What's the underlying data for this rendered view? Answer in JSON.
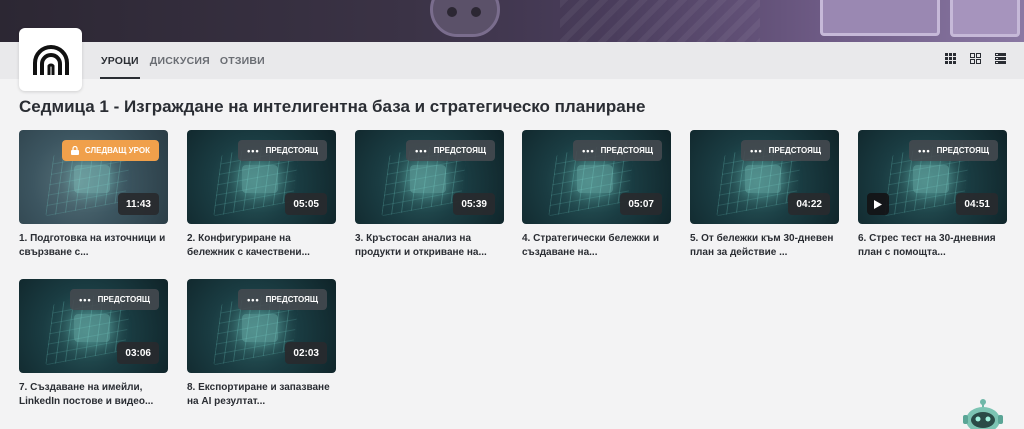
{
  "tabs": [
    {
      "label": "УРОЦИ",
      "active": true
    },
    {
      "label": "ДИСКУСИЯ",
      "active": false
    },
    {
      "label": "ОТЗИВИ",
      "active": false
    }
  ],
  "view_icons": [
    "grid-small-icon",
    "grid-large-icon",
    "list-icon"
  ],
  "section": {
    "title": "Седмица 1 - Изграждане на интелигентна база и стратегическо планиране"
  },
  "lessons": [
    {
      "title": "1. Подготовка на източници и свързване с...",
      "duration": "11:43",
      "badge": "СЛЕДВАЩ УРОК",
      "badge_type": "next"
    },
    {
      "title": "2. Конфигуриране на бележник с качествени...",
      "duration": "05:05",
      "badge": "ПРЕДСТОЯЩ",
      "badge_type": "upcoming"
    },
    {
      "title": "3. Кръстосан анализ на продукти и откриване на...",
      "duration": "05:39",
      "badge": "ПРЕДСТОЯЩ",
      "badge_type": "upcoming"
    },
    {
      "title": "4. Стратегически бележки и създаване на...",
      "duration": "05:07",
      "badge": "ПРЕДСТОЯЩ",
      "badge_type": "upcoming"
    },
    {
      "title": "5. От бележки към 30-дневен план за действие ...",
      "duration": "04:22",
      "badge": "ПРЕДСТОЯЩ",
      "badge_type": "upcoming"
    },
    {
      "title": "6. Стрес тест на 30-дневния план с помощта...",
      "duration": "04:51",
      "badge": "ПРЕДСТОЯЩ",
      "badge_type": "upcoming",
      "has_play": true
    },
    {
      "title": "7. Създаване на имейли, LinkedIn постове и видео...",
      "duration": "03:06",
      "badge": "ПРЕДСТОЯЩ",
      "badge_type": "upcoming"
    },
    {
      "title": "8. Експортиране и запазване на AI резултат...",
      "duration": "02:03",
      "badge": "ПРЕДСТОЯЩ",
      "badge_type": "upcoming"
    }
  ],
  "colors": {
    "accent_next": "#f0a04b",
    "text_primary": "#2a2d33",
    "navbar_bg": "#e9e9eb",
    "page_bg": "#f3f3f4"
  }
}
